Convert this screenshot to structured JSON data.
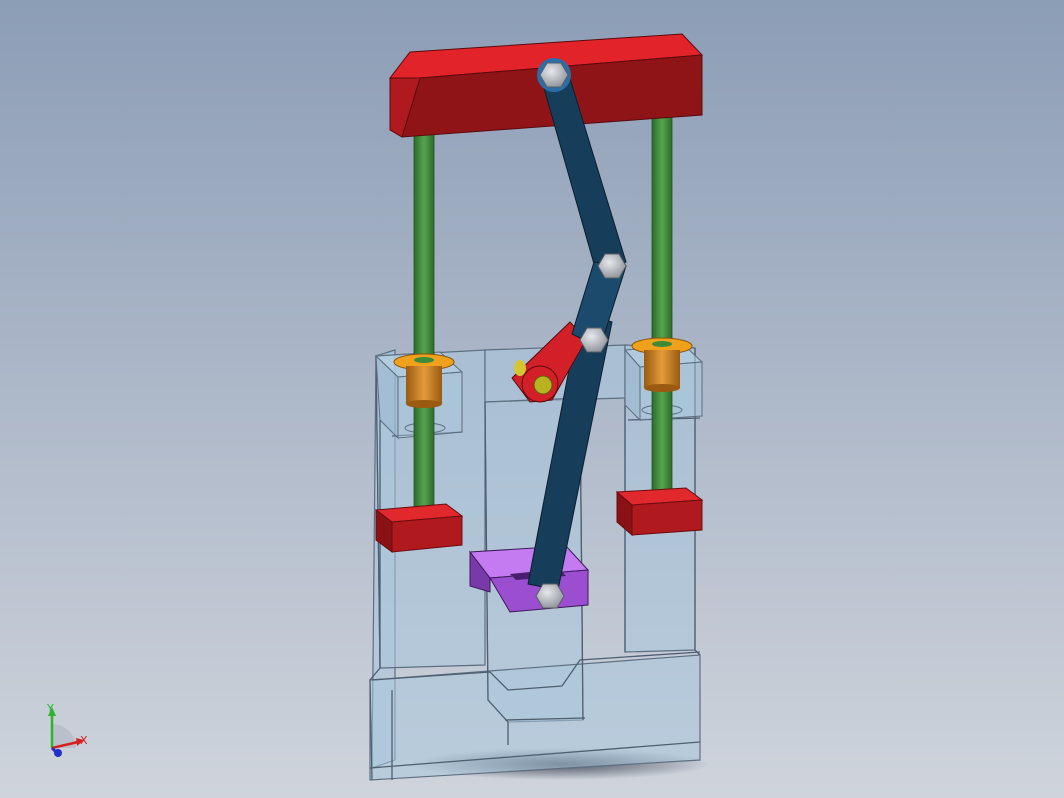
{
  "viewport": {
    "background_top": "#8c9db6",
    "background_bottom": "#cfd4dc"
  },
  "model": {
    "frame_color": "#a9c7dd",
    "frame_edge": "#5d6f80",
    "top_plate_color": "#8f1418",
    "rod_color": "#3f8a3a",
    "link_color": "#163d5a",
    "crank_color": "#c81e1e",
    "slider_color": "#9b4fd0",
    "block_color": "#c11c22",
    "bushing_color": "#c87a1a",
    "bolt_color": "#c9ccd1"
  },
  "triad": {
    "y_label": "Y",
    "x_label": "X",
    "y_color": "#2bb52b",
    "x_color": "#d42020",
    "z_color": "#2030c8"
  }
}
